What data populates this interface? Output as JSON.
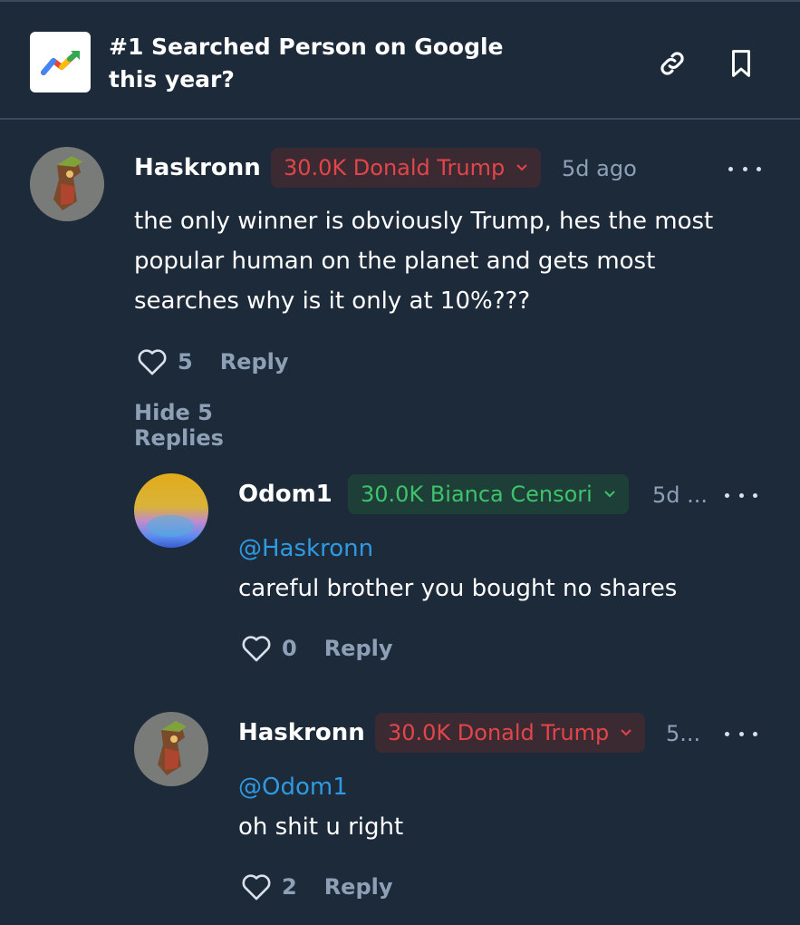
{
  "header": {
    "title_line1": "#1 Searched Person on Google",
    "title_line2": "this year?",
    "link_icon": "link-icon",
    "bookmark_icon": "bookmark-icon"
  },
  "colors": {
    "background": "#1d2a3a",
    "red_badge": "#e2454a",
    "green_badge": "#3ec26b",
    "mention": "#2f9ae0",
    "muted": "#8ea0b6"
  },
  "comment": {
    "username": "Haskronn",
    "position": "30.0K Donald Trump",
    "time": "5d ago",
    "text_line1": "the only winner is obviously Trump, hes the most",
    "text_line2": "popular human on the planet and gets most",
    "text_line3": "searches why is it only at 10%???",
    "likes": "5",
    "reply_label": "Reply",
    "hide_replies": "Hide 5 Replies"
  },
  "replies": [
    {
      "username": "Odom1",
      "position": "30.0K Bianca Censori",
      "time": "5d ...",
      "mention": "@Haskronn",
      "text": "careful brother you bought no shares",
      "likes": "0",
      "reply_label": "Reply"
    },
    {
      "username": "Haskronn",
      "position": "30.0K Donald Trump",
      "time": "5...",
      "mention": "@Odom1",
      "text": "oh shit u right",
      "likes": "2",
      "reply_label": "Reply"
    }
  ]
}
